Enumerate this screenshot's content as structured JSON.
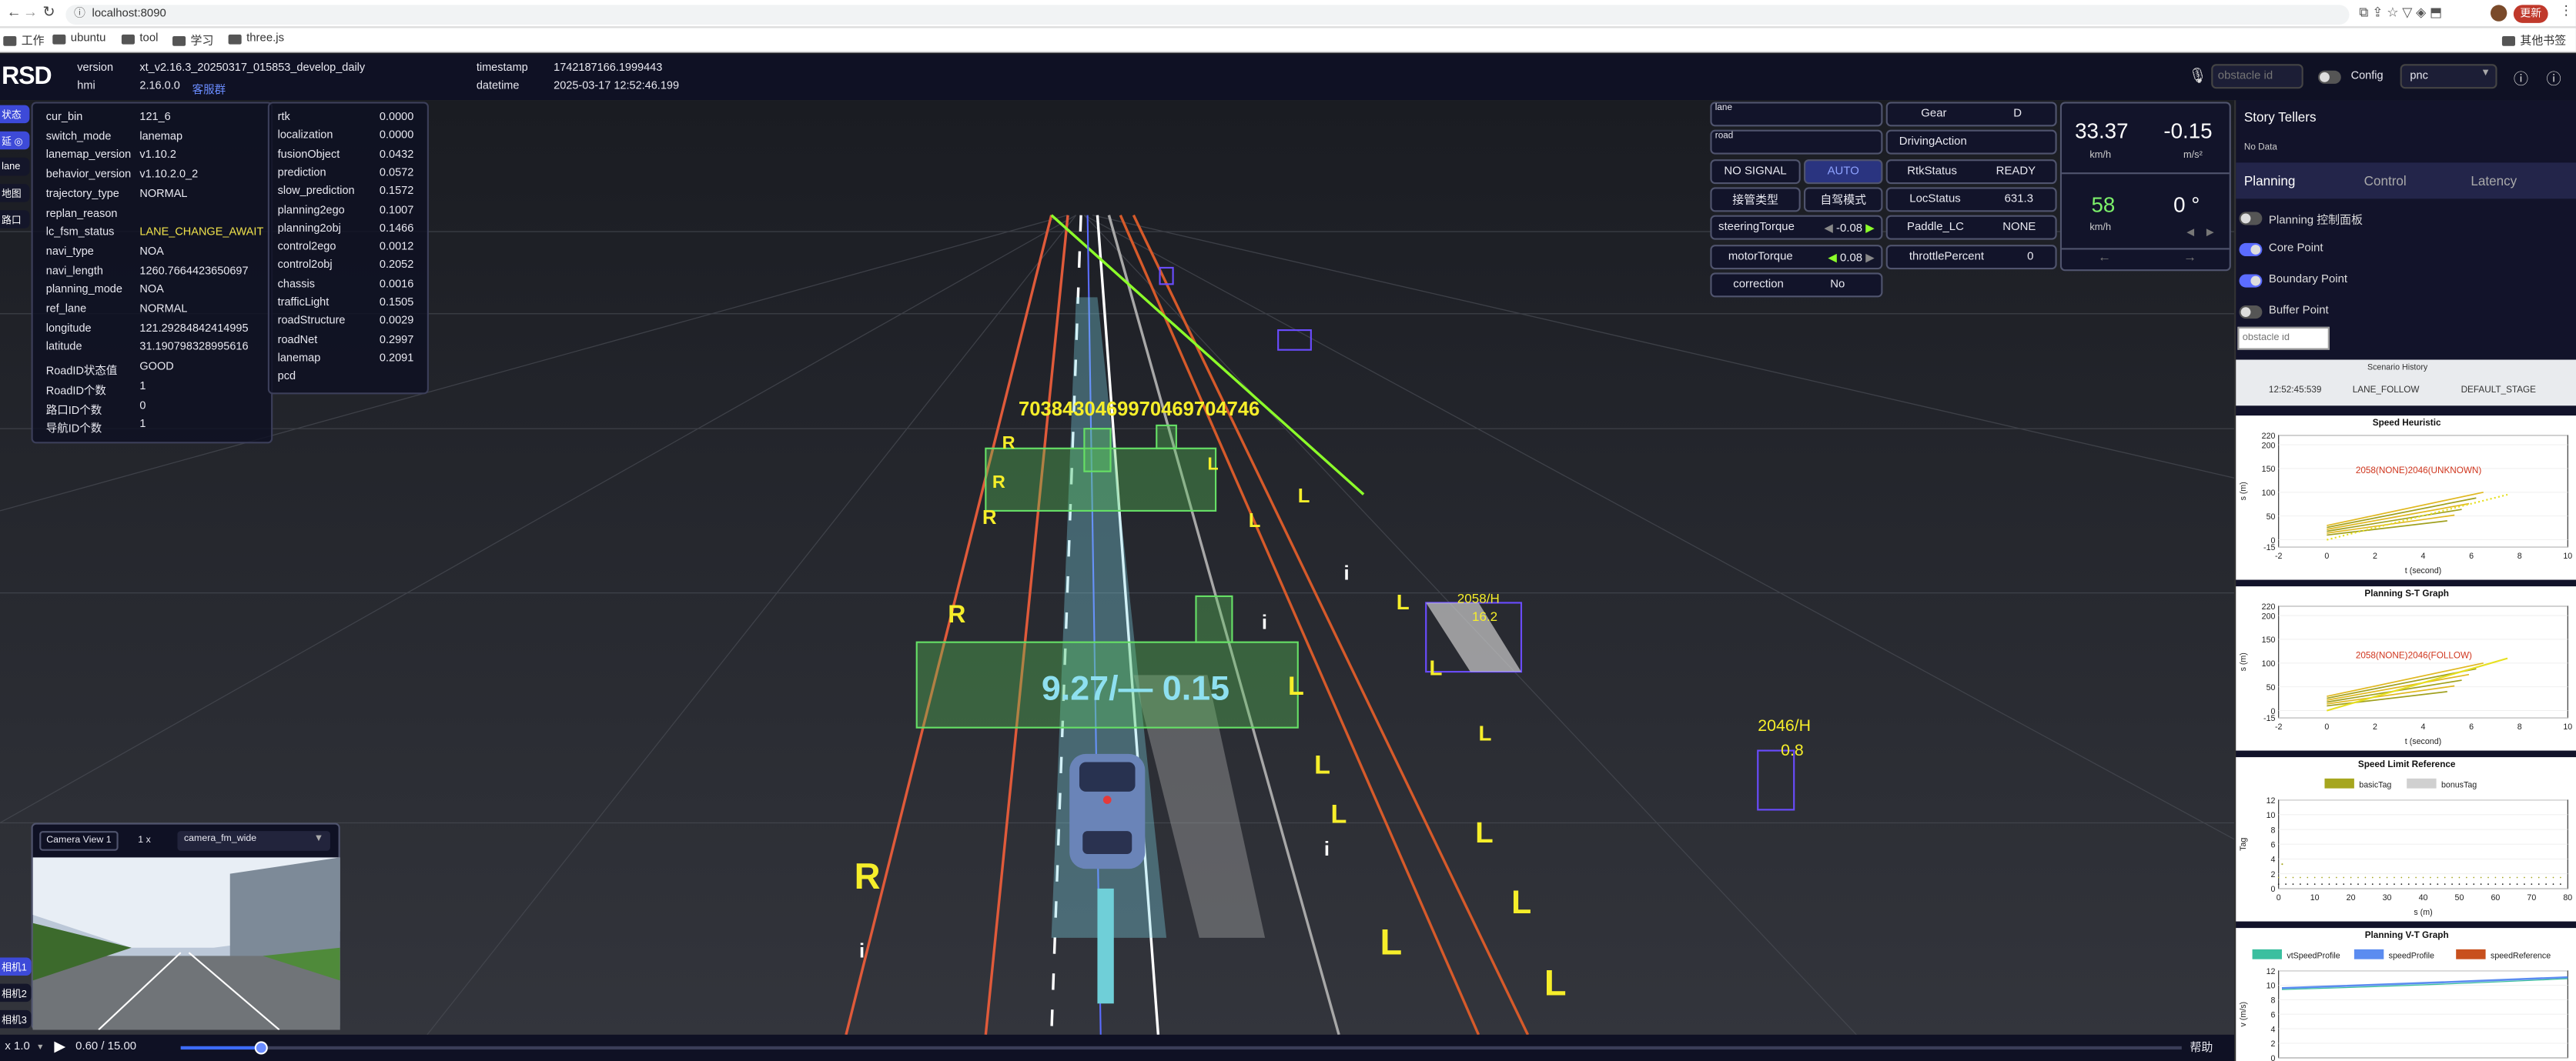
{
  "browser": {
    "url": "localhost:8090",
    "update_label": "更新",
    "other_bookmarks": "其他书签",
    "bookmarks": [
      "工作",
      "ubuntu",
      "tool",
      "学习",
      "three.js"
    ]
  },
  "header": {
    "logo": "RSD",
    "version_label": "version",
    "version_value": "xt_v2.16.3_20250317_015853_develop_daily",
    "hmi_label": "hmi",
    "hmi_value": "2.16.0.0",
    "service_link": "客服群",
    "timestamp_label": "timestamp",
    "timestamp_value": "1742187166.1999443",
    "datetime_label": "datetime",
    "datetime_value": "2025-03-17 12:52:46.199",
    "obstacle_placeholder": "obstacle id",
    "config_label": "Config",
    "mode_value": "pnc"
  },
  "left_tabs": [
    "状态",
    "延 ◎",
    "lane",
    "地图",
    "路口"
  ],
  "camera_tabs": [
    "相机1",
    "相机2",
    "相机3"
  ],
  "info_panel": [
    {
      "k": "cur_bin",
      "v": "121_6"
    },
    {
      "k": "switch_mode",
      "v": "lanemap"
    },
    {
      "k": "lanemap_version",
      "v": "v1.10.2"
    },
    {
      "k": "behavior_version",
      "v": "v1.10.2.0_2"
    },
    {
      "k": "trajectory_type",
      "v": "NORMAL"
    },
    {
      "k": "replan_reason",
      "v": ""
    },
    {
      "k": "lc_fsm_status",
      "v": "LANE_CHANGE_AWAIT"
    },
    {
      "k": "navi_type",
      "v": "NOA"
    },
    {
      "k": "navi_length",
      "v": "1260.7664423650697"
    },
    {
      "k": "planning_mode",
      "v": "NOA"
    },
    {
      "k": "ref_lane",
      "v": "NORMAL"
    },
    {
      "k": "longitude",
      "v": "121.29284842414995"
    },
    {
      "k": "latitude",
      "v": "31.190798328995616"
    },
    {
      "k": "RoadID状态值",
      "v": "GOOD"
    },
    {
      "k": "RoadID个数",
      "v": "1"
    },
    {
      "k": "路口ID个数",
      "v": "0"
    },
    {
      "k": "导航ID个数",
      "v": "1"
    }
  ],
  "latency_panel": [
    {
      "k": "rtk",
      "v": "0.0000"
    },
    {
      "k": "localization",
      "v": "0.0000"
    },
    {
      "k": "fusionObject",
      "v": "0.0432"
    },
    {
      "k": "prediction",
      "v": "0.0572"
    },
    {
      "k": "slow_prediction",
      "v": "0.1572"
    },
    {
      "k": "planning2ego",
      "v": "0.1007"
    },
    {
      "k": "planning2obj",
      "v": "0.1466"
    },
    {
      "k": "control2ego",
      "v": "0.0012"
    },
    {
      "k": "control2obj",
      "v": "0.2052"
    },
    {
      "k": "chassis",
      "v": "0.0016"
    },
    {
      "k": "trafficLight",
      "v": "0.1505"
    },
    {
      "k": "roadStructure",
      "v": "0.0029"
    },
    {
      "k": "roadNet",
      "v": "0.2997"
    },
    {
      "k": "lanemap",
      "v": "0.2091"
    },
    {
      "k": "pcd",
      "v": ""
    }
  ],
  "status": {
    "lane_label": "lane",
    "road_label": "road",
    "no_signal": "NO SIGNAL",
    "auto": "AUTO",
    "takeover_type": "接管类型",
    "self_mode": "自驾模式",
    "steering_label": "steeringTorque",
    "steering_value": "-0.08",
    "motor_label": "motorTorque",
    "motor_value": "0.08",
    "correction_label": "correction",
    "correction_value": "No",
    "gear_label": "Gear",
    "gear_value": "D",
    "driving_action": "DrivingAction",
    "rtk_label": "RtkStatus",
    "rtk_value": "READY",
    "loc_label": "LocStatus",
    "loc_value": "631.3",
    "paddle_label": "Paddle_LC",
    "paddle_value": "NONE",
    "throttle_label": "throttlePercent",
    "throttle_value": "0"
  },
  "speed": {
    "speed": "33.37",
    "speed_unit": "km/h",
    "accel": "-0.15",
    "accel_unit": "m/s²",
    "limit": "58",
    "limit_unit": "km/h",
    "angle": "0 °"
  },
  "scene_labels": {
    "speed_overlay": "9.27/— 0.15",
    "ids": "7038430469970469704746",
    "obj1": "2058/H",
    "obj1b": "16.2",
    "obj2": "2046/H",
    "obj2b": "0.8"
  },
  "camera": {
    "view": "Camera View 1",
    "zoom": "1 x",
    "source": "camera_fm_wide"
  },
  "playback": {
    "speed": "x 1.0",
    "time": "0.60 / 15.00",
    "help": "帮助",
    "progress": 0.04
  },
  "right": {
    "title": "Story Tellers",
    "no_data": "No Data",
    "tabs": [
      "Planning",
      "Control",
      "Latency"
    ],
    "toggles": [
      {
        "label": "Planning 控制面板",
        "on": false
      },
      {
        "label": "Core Point",
        "on": true
      },
      {
        "label": "Boundary Point",
        "on": true
      },
      {
        "label": "Buffer Point",
        "on": false
      }
    ],
    "obstacle_placeholder": "obstacle id",
    "scenario_title": "Scenario History",
    "scenario_row": [
      "12:52:45:539",
      "LANE_FOLLOW",
      "DEFAULT_STAGE"
    ]
  },
  "chart_data": [
    {
      "type": "scatter",
      "title": "Speed Heuristic",
      "xlabel": "t (second)",
      "ylabel": "s (m)",
      "xlim": [
        -2,
        10
      ],
      "ylim": [
        -15,
        220
      ],
      "yticks": [
        -15,
        0,
        50,
        100,
        150,
        200,
        220
      ],
      "xticks": [
        -2,
        0,
        2,
        4,
        6,
        8,
        10
      ],
      "annotation": "2058(NONE)2046(UNKNOWN)"
    },
    {
      "type": "line",
      "title": "Planning S-T Graph",
      "xlabel": "t (second)",
      "ylabel": "s (m)",
      "xlim": [
        -2,
        10
      ],
      "ylim": [
        -15,
        220
      ],
      "yticks": [
        -15,
        0,
        50,
        100,
        150,
        200,
        220
      ],
      "xticks": [
        -2,
        0,
        2,
        4,
        6,
        8,
        10
      ],
      "annotation": "2058(NONE)2046(FOLLOW)"
    },
    {
      "type": "line",
      "title": "Speed Limit Reference",
      "xlabel": "s (m)",
      "ylabel": "Tag",
      "xlim": [
        0,
        80
      ],
      "ylim": [
        0,
        12
      ],
      "yticks": [
        0,
        2,
        4,
        6,
        8,
        10,
        12
      ],
      "xticks": [
        0,
        10,
        20,
        30,
        40,
        50,
        60,
        70,
        80
      ],
      "legend": [
        "basicTag",
        "bonusTag"
      ],
      "legend_colors": [
        "#a6a61e",
        "#d0d0d0"
      ]
    },
    {
      "type": "line",
      "title": "Planning V-T Graph",
      "ylabel": "v (m/s)",
      "ylim": [
        0,
        12
      ],
      "yticks": [
        0,
        2,
        4,
        6,
        8,
        10,
        12
      ],
      "legend": [
        "vtSpeedProfile",
        "speedProfile",
        "speedReference"
      ],
      "legend_colors": [
        "#3bbf9f",
        "#5b8cf0",
        "#c8501e"
      ]
    }
  ]
}
